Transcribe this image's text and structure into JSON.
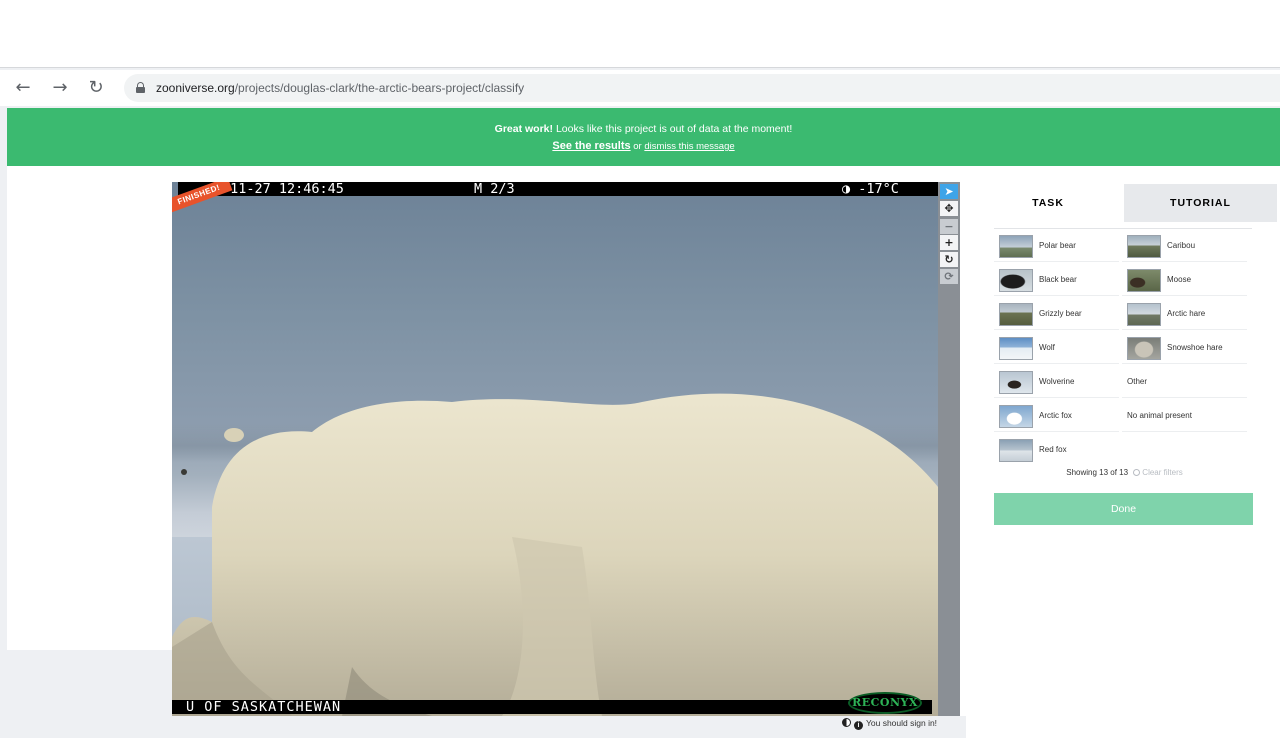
{
  "browser": {
    "back_icon": "←",
    "forward_icon": "→",
    "reload_icon": "↻",
    "url_host": "zooniverse.org",
    "url_path": "/projects/douglas-clark/the-arctic-bears-project/classify"
  },
  "banner": {
    "bold": "Great work!",
    "message": " Looks like this project is out of data at the moment!",
    "results_link": "See the results",
    "or": " or ",
    "dismiss_link": "dismiss this message",
    "color": "#3bba70"
  },
  "image": {
    "timestamp": "-11-27 12:46:45",
    "sequence": "M 2/3",
    "temperature": "◑ -17°C",
    "caption": "U OF SASKATCHEWAN",
    "brand": "RECONYX",
    "badge": "FINISHED!"
  },
  "toolbar": {
    "pointer": "➤",
    "move": "✥",
    "zoom_out": "−",
    "zoom_in": "+",
    "rotate": "↻",
    "reset": "⟳"
  },
  "panel": {
    "tabs": {
      "task": "TASK",
      "tutorial": "TUTORIAL"
    },
    "choices": [
      {
        "label": "Polar bear",
        "thumb": "polar-bear-thumb"
      },
      {
        "label": "Caribou",
        "thumb": "caribou-thumb"
      },
      {
        "label": "Black bear",
        "thumb": "black-bear-thumb"
      },
      {
        "label": "Moose",
        "thumb": "moose-thumb"
      },
      {
        "label": "Grizzly bear",
        "thumb": "grizzly-bear-thumb"
      },
      {
        "label": "Arctic hare",
        "thumb": "arctic-hare-thumb"
      },
      {
        "label": "Wolf",
        "thumb": "wolf-thumb"
      },
      {
        "label": "Snowshoe hare",
        "thumb": "snowshoe-hare-thumb"
      },
      {
        "label": "Wolverine",
        "thumb": "wolverine-thumb"
      },
      {
        "label": "Other"
      },
      {
        "label": "Arctic fox",
        "thumb": "arctic-fox-thumb"
      },
      {
        "label": "No animal present"
      },
      {
        "label": "Red fox",
        "thumb": "red-fox-thumb"
      }
    ],
    "showing": "Showing 13 of 13",
    "clear_filters": "Clear filters",
    "done": "Done",
    "done_color": "#7fd3ab"
  },
  "footer": {
    "signin": "You should sign in!"
  }
}
